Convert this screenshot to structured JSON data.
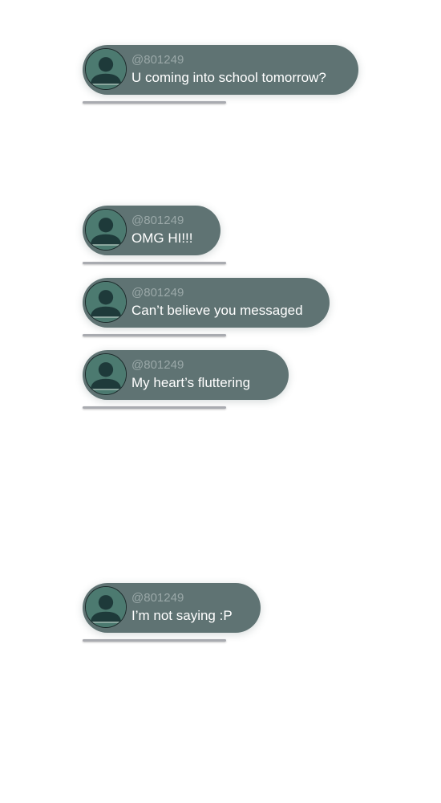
{
  "messages": [
    {
      "handle": "@801249",
      "text": "U coming into school tomorrow?"
    },
    {
      "handle": "@801249",
      "text": "OMG HI!!!"
    },
    {
      "handle": "@801249",
      "text": "Can’t believe you messaged"
    },
    {
      "handle": "@801249",
      "text": "My heart’s fluttering"
    },
    {
      "handle": "@801249",
      "text": "I’m not saying :P"
    }
  ],
  "colors": {
    "bubble": "#5f7373",
    "avatar_bg": "#4c7a70",
    "avatar_figure": "#1e3a3a",
    "handle_text": "#9aa8a8",
    "message_text": "#ffffff",
    "underline": "#a9abb0"
  },
  "icons": {
    "avatar": "user-silhouette-icon"
  }
}
